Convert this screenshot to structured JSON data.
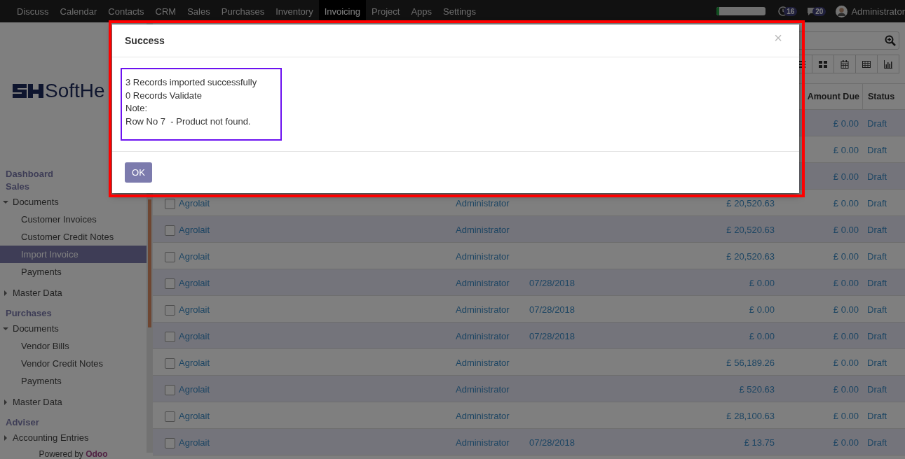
{
  "top_nav": {
    "menus": [
      {
        "label": "Discuss",
        "selected": false
      },
      {
        "label": "Calendar",
        "selected": false
      },
      {
        "label": "Contacts",
        "selected": false
      },
      {
        "label": "CRM",
        "selected": false
      },
      {
        "label": "Sales",
        "selected": false
      },
      {
        "label": "Purchases",
        "selected": false
      },
      {
        "label": "Inventory",
        "selected": false
      },
      {
        "label": "Invoicing",
        "selected": true
      },
      {
        "label": "Project",
        "selected": false
      },
      {
        "label": "Apps",
        "selected": false
      },
      {
        "label": "Settings",
        "selected": false
      }
    ],
    "progress": {
      "level": 0.06
    },
    "activity_count": "16",
    "message_count": "20",
    "user": "Administrator"
  },
  "sidebar": {
    "brand": "SoftHe",
    "sections": [
      {
        "label": "Dashboard"
      },
      {
        "label": "Sales",
        "children": [
          {
            "label": "Documents",
            "expanded": true,
            "children": [
              {
                "label": "Customer Invoices",
                "selected": false
              },
              {
                "label": "Customer Credit Notes",
                "selected": false
              },
              {
                "label": "Import Invoice",
                "selected": true
              },
              {
                "label": "Payments",
                "selected": false
              }
            ]
          },
          {
            "label": "Master Data",
            "expanded": false
          }
        ]
      },
      {
        "label": "Purchases",
        "children": [
          {
            "label": "Documents",
            "expanded": true,
            "children": [
              {
                "label": "Vendor Bills",
                "selected": false
              },
              {
                "label": "Vendor Credit Notes",
                "selected": false
              },
              {
                "label": "Payments",
                "selected": false
              }
            ]
          },
          {
            "label": "Master Data",
            "expanded": false
          }
        ]
      },
      {
        "label": "Adviser",
        "children": [
          {
            "label": "Accounting Entries",
            "expanded": false
          }
        ]
      }
    ],
    "footer": "Powered by **Odoo**"
  },
  "control_panel": {
    "views": [
      {
        "kind": "list"
      },
      {
        "kind": "kanban"
      },
      {
        "kind": "calendar"
      },
      {
        "kind": "pivot"
      },
      {
        "kind": "graph"
      }
    ]
  },
  "table": {
    "columns": {
      "amount_due": "Amount Due",
      "status": "Status"
    },
    "rows": [
      {
        "amount_due": "£ 0.00",
        "status": "Draft"
      },
      {
        "amount_due": "£ 0.00",
        "status": "Draft"
      },
      {
        "amount_due": "£ 0.00",
        "status": "Draft"
      },
      {
        "checked": false,
        "customer": "Agrolait",
        "salesperson": "Administrator",
        "total": "£ 20,520.63",
        "amount_due": "£ 0.00",
        "status": "Draft"
      },
      {
        "checked": false,
        "customer": "Agrolait",
        "salesperson": "Administrator",
        "total": "£ 20,520.63",
        "amount_due": "£ 0.00",
        "status": "Draft"
      },
      {
        "checked": false,
        "customer": "Agrolait",
        "salesperson": "Administrator",
        "total": "£ 20,520.63",
        "amount_due": "£ 0.00",
        "status": "Draft"
      },
      {
        "checked": false,
        "customer": "Agrolait",
        "salesperson": "Administrator",
        "due_date": "07/28/2018",
        "total": "£ 0.00",
        "amount_due": "£ 0.00",
        "status": "Draft"
      },
      {
        "checked": false,
        "customer": "Agrolait",
        "salesperson": "Administrator",
        "due_date": "07/28/2018",
        "total": "£ 0.00",
        "amount_due": "£ 0.00",
        "status": "Draft"
      },
      {
        "checked": false,
        "customer": "Agrolait",
        "salesperson": "Administrator",
        "due_date": "07/28/2018",
        "total": "£ 0.00",
        "amount_due": "£ 0.00",
        "status": "Draft"
      },
      {
        "checked": false,
        "customer": "Agrolait",
        "salesperson": "Administrator",
        "total": "£ 56,189.26",
        "amount_due": "£ 0.00",
        "status": "Draft"
      },
      {
        "checked": false,
        "customer": "Agrolait",
        "salesperson": "Administrator",
        "total": "£ 520.63",
        "amount_due": "£ 0.00",
        "status": "Draft"
      },
      {
        "checked": false,
        "customer": "Agrolait",
        "salesperson": "Administrator",
        "total": "£ 28,100.63",
        "amount_due": "£ 0.00",
        "status": "Draft"
      },
      {
        "checked": false,
        "customer": "Agrolait",
        "salesperson": "Administrator",
        "due_date": "07/28/2018",
        "total": "£ 13.75",
        "amount_due": "£ 0.00",
        "status": "Draft"
      }
    ]
  },
  "dialog": {
    "title": "Success",
    "close": "×",
    "message_lines": [
      "3 Records imported successfully",
      "0 Records Validate",
      "Note:",
      "Row No 7  - Product not found."
    ],
    "ok": "OK"
  }
}
